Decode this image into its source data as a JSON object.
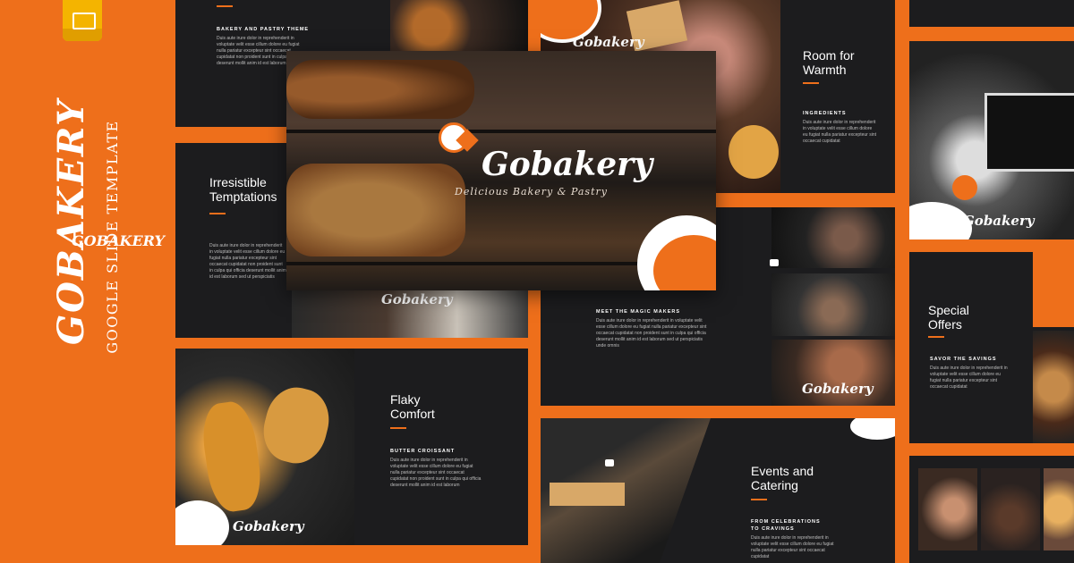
{
  "brand": {
    "name": "GOBAKERY",
    "subtitle": "GOOGLE SLIDE TEMPLATE",
    "wordmark": "Gobakery",
    "tagline": "Delicious Bakery & Pastry",
    "icon": "google-slides-icon",
    "colors": {
      "accent": "#ee6f1b",
      "panel": "#1c1c1e",
      "text": "#ffffff"
    }
  },
  "slides": {
    "theme": {
      "label": "BAKERY AND PASTRY THEME",
      "text": "Duis aute irure dolor in reprehenderit in voluptate velit esse cillum dolore eu fugiat nulla pariatur excepteur sint occaecat cupidatat non proident sunt in culpa qui officia deserunt mollit anim id est laborum"
    },
    "irresistible": {
      "title_1": "Irresistible",
      "title_2": "Temptations",
      "text": "Duis aute irure dolor in reprehenderit in voluptate velit esse cillum dolore eu fugiat nulla pariatur excepteur sint occaecat cupidatat non proident sunt in culpa qui officia deserunt mollit anim id est laborum sed ut perspiciatis"
    },
    "room": {
      "title_1": "Room for",
      "title_2": "Warmth",
      "label": "INGREDIENTS",
      "text": "Duis aute irure dolor in reprehenderit in voluptate velit esse cillum dolore eu fugiat nulla pariatur excepteur sint occaecat cupidatat"
    },
    "makers": {
      "label": "MEET THE MAGIC MAKERS",
      "text": "Duis aute irure dolor in reprehenderit in voluptate velit esse cillum dolore eu fugiat nulla pariatur excepteur sint occaecat cupidatat non proident sunt in culpa qui officia deserunt mollit anim id est laborum sed ut perspiciatis unde omnis"
    },
    "special": {
      "title_1": "Special",
      "title_2": "Offers",
      "label": "SAVOR THE SAVINGS",
      "text": "Duis aute irure dolor in reprehenderit in voluptate velit esse cillum dolore eu fugiat nulla pariatur excepteur sint occaecat cupidatat"
    },
    "flaky": {
      "title_1": "Flaky",
      "title_2": "Comfort",
      "label": "BUTTER CROISSANT",
      "text": "Duis aute irure dolor in reprehenderit in voluptate velit esse cillum dolore eu fugiat nulla pariatur excepteur sint occaecat cupidatat non proident sunt in culpa qui officia deserunt mollit anim id est laborum"
    },
    "events": {
      "title_1": "Events and",
      "title_2": "Catering",
      "label_1": "FROM CELEBRATIONS",
      "label_2": "TO CRAVINGS",
      "text": "Duis aute irure dolor in reprehenderit in voluptate velit esse cillum dolore eu fugiat nulla pariatur excepteur sint occaecat cupidatat"
    }
  }
}
